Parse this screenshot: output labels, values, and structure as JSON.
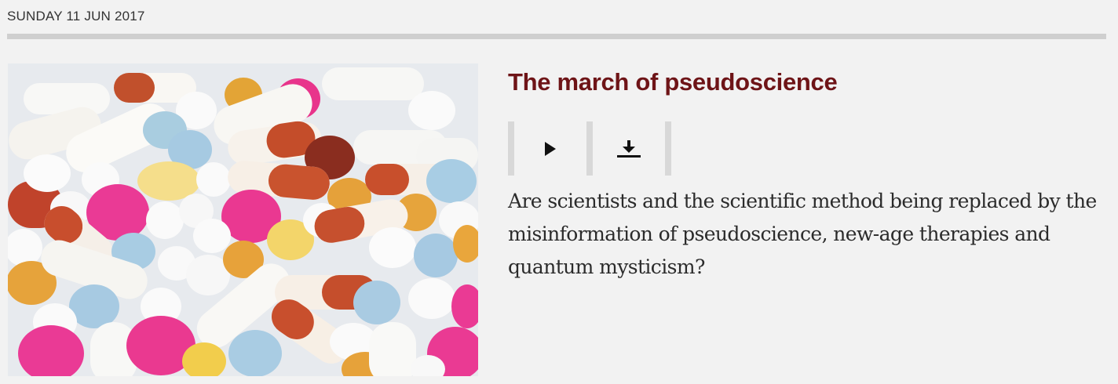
{
  "episode": {
    "date": "SUNDAY 11 JUN 2017",
    "title": "The march of pseudoscience",
    "summary": "Are scientists and the scientific method being replaced by the misinformation of pseudoscience, new-age therapies and quantum mysticism?",
    "image_subject": "pills-and-capsules"
  },
  "controls": {
    "play_icon": "play-icon",
    "download_icon": "download-icon"
  },
  "colors": {
    "title": "#6e1417",
    "rule": "#cfcfcf",
    "background": "#f2f2f2"
  }
}
